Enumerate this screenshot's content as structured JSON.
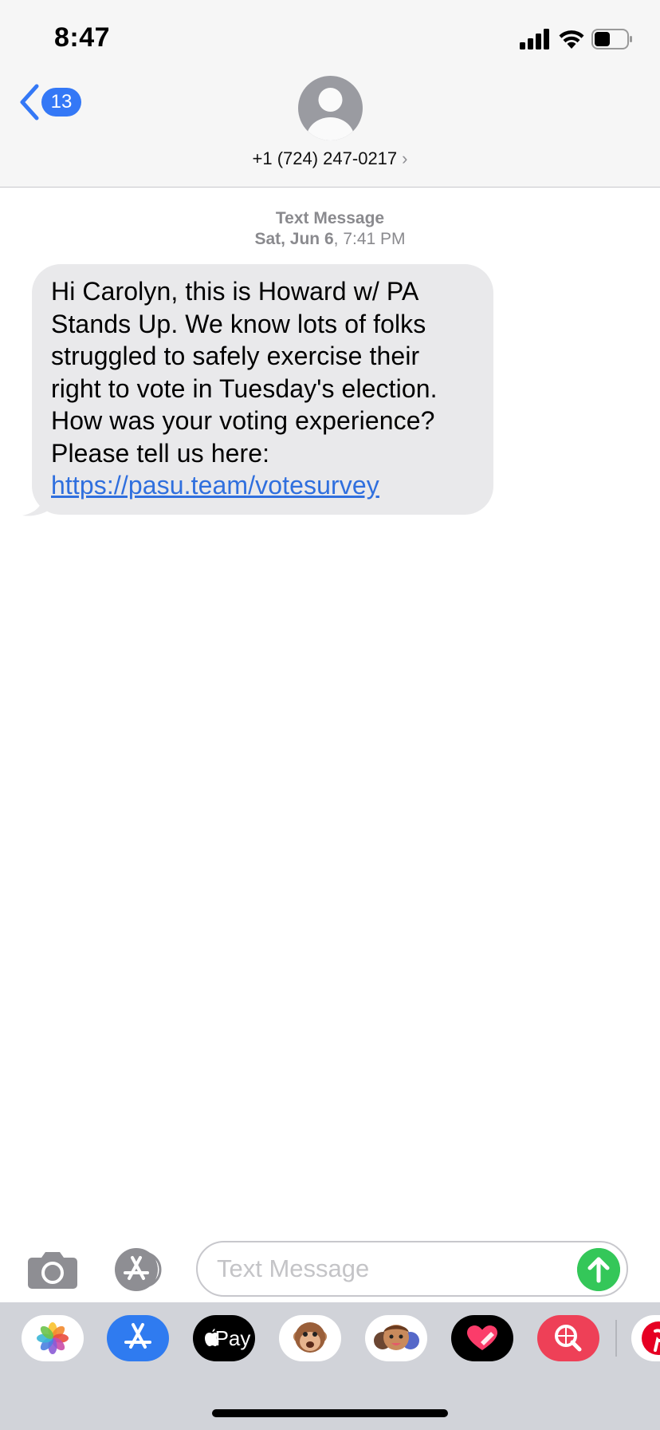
{
  "status_bar": {
    "time": "8:47",
    "icons": [
      "cellular-signal-icon",
      "wifi-icon",
      "battery-icon"
    ]
  },
  "header": {
    "back_badge_count": "13",
    "contact": "+1 (724) 247-0217",
    "contact_chevron": "›"
  },
  "conversation": {
    "message_type": "Text Message",
    "date_bold": "Sat, Jun 6",
    "date_rest": ", 7:41 PM",
    "messages": [
      {
        "direction": "incoming",
        "text": "Hi Carolyn, this is Howard w/ PA Stands Up. We know lots of folks struggled to safely exercise their right to vote in Tuesday's election. How was your voting experience? Please tell us here: ",
        "link": "https://pasu.team/votesurvey"
      }
    ]
  },
  "input_bar": {
    "placeholder": "Text Message",
    "value": ""
  },
  "app_drawer": {
    "apps": [
      "photos-app-icon",
      "app-store-app-icon",
      "apple-pay-app-icon",
      "animoji-app-icon",
      "memoji-app-icon",
      "digital-touch-app-icon",
      "search-images-app-icon",
      "pinterest-app-icon"
    ],
    "apple_pay_label": "Pay"
  },
  "colors": {
    "accent_blue": "#3478f6",
    "link_blue": "#2f6fde",
    "bubble_gray": "#e9e9eb",
    "send_green": "#34c759",
    "header_bg": "#f6f6f6",
    "drawer_bg": "#d1d3d9"
  }
}
